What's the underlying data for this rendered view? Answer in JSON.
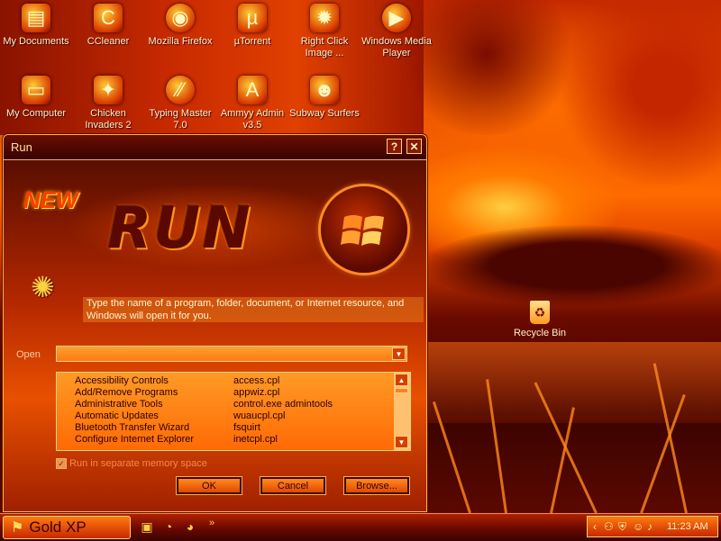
{
  "desktop": {
    "icons": [
      {
        "label": "My Documents",
        "icon": "folder-documents-icon"
      },
      {
        "label": "CCleaner",
        "icon": "ccleaner-icon"
      },
      {
        "label": "Mozilla Firefox",
        "icon": "firefox-icon"
      },
      {
        "label": "µTorrent",
        "icon": "utorrent-icon"
      },
      {
        "label": "Right Click Image ...",
        "icon": "right-click-image-icon"
      },
      {
        "label": "Windows Media Player",
        "icon": "media-player-icon"
      },
      {
        "label": "My Computer",
        "icon": "computer-icon"
      },
      {
        "label": "Chicken Invaders 2",
        "icon": "chicken-invaders-icon"
      },
      {
        "label": "Typing Master 7.0",
        "icon": "typing-master-icon"
      },
      {
        "label": "Ammyy Admin v3.5",
        "icon": "ammyy-admin-icon"
      },
      {
        "label": "Subway Surfers",
        "icon": "subway-surfers-icon"
      },
      {
        "label": "Recycle Bin",
        "icon": "recycle-bin-icon"
      }
    ]
  },
  "run_dialog": {
    "title": "Run",
    "help_button": "?",
    "close_button": "✕",
    "banner_badge": "NEW",
    "banner_logo": "RUN",
    "prompt": "Type the name of a program, folder, document, or Internet resource, and Windows will open it for you.",
    "open_label": "Open",
    "open_value": "",
    "history": [
      {
        "name": "Accessibility Controls",
        "command": "access.cpl"
      },
      {
        "name": "Add/Remove Programs",
        "command": "appwiz.cpl"
      },
      {
        "name": "Administrative Tools",
        "command": "control.exe admintools"
      },
      {
        "name": "Automatic Updates",
        "command": "wuaucpl.cpl"
      },
      {
        "name": "Bluetooth Transfer Wizard",
        "command": "fsquirt"
      },
      {
        "name": "Configure Internet Explorer",
        "command": "inetcpl.cpl"
      }
    ],
    "sandbox_label": "Run in separate memory space",
    "sandbox_checked": true,
    "ok_label": "OK",
    "cancel_label": "Cancel",
    "browse_label": "Browse..."
  },
  "taskbar": {
    "start_label": "Gold XP",
    "overflow": "»",
    "clock": "11:23 AM"
  },
  "colors": {
    "accent": "#ff6a00",
    "border": "#ffb640",
    "text_light": "#fff0c8"
  }
}
